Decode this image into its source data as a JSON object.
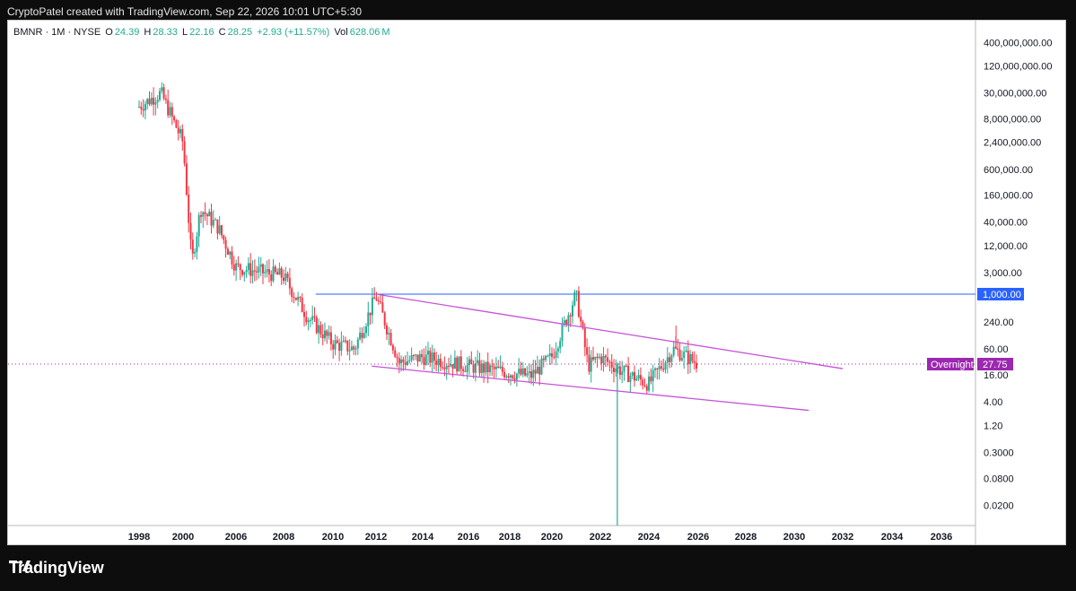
{
  "header": {
    "text": "CryptoPatel created with TradingView.com, Sep 22, 2026 10:01 UTC+5:30"
  },
  "legend": {
    "symbol": "BMNR · 1M · NYSE",
    "o_label": "O",
    "o_value": "24.39",
    "h_label": "H",
    "h_value": "28.33",
    "l_label": "L",
    "l_value": "22.16",
    "c_label": "C",
    "c_value": "28.25",
    "change": "+2.93 (+11.57%)",
    "vol_label": "Vol",
    "vol_value": "628.06",
    "vol_unit": "M"
  },
  "brand": {
    "name": "TradingView"
  },
  "colors": {
    "up": "#22ab94",
    "down": "#f23645",
    "channel": "#c653d8",
    "level": "#2962ff",
    "overnight": "#9c27b0"
  },
  "chart_data": {
    "type": "candlestick",
    "scale": "log",
    "x_ticks": [
      "1998",
      "2000",
      "2006",
      "2008",
      "2010",
      "2012",
      "2014",
      "2016",
      "2018",
      "2020",
      "2022",
      "2024",
      "2026",
      "2028",
      "2030",
      "2032",
      "2034",
      "2036"
    ],
    "y_ticks": [
      "400,000,000.00",
      "120,000,000.00",
      "30,000,000.00",
      "8,000,000.00",
      "2,400,000.00",
      "600,000.00",
      "160,000.00",
      "40,000.00",
      "12,000.00",
      "3,000.00",
      "240.00",
      "60.00",
      "16.00",
      "4.00",
      "1.20",
      "0.3000",
      "0.0800",
      "0.0200"
    ],
    "horizontal_level": {
      "value": 1000,
      "label": "1,000.00"
    },
    "current_price": {
      "label": "Overnight",
      "value": "27.75"
    },
    "series_path": [
      {
        "x": "1998",
        "y": 15000000
      },
      {
        "x": "1999",
        "y": 30000000
      },
      {
        "x": "2000",
        "y": 2400000
      },
      {
        "x": "2001",
        "y": 5000
      },
      {
        "x": "2002",
        "y": 80000
      },
      {
        "x": "2004",
        "y": 30000
      },
      {
        "x": "2006",
        "y": 4000
      },
      {
        "x": "2008",
        "y": 2500
      },
      {
        "x": "2009",
        "y": 300
      },
      {
        "x": "2010",
        "y": 80
      },
      {
        "x": "2011",
        "y": 60
      },
      {
        "x": "2012",
        "y": 900
      },
      {
        "x": "2013",
        "y": 30
      },
      {
        "x": "2014",
        "y": 40
      },
      {
        "x": "2016",
        "y": 25
      },
      {
        "x": "2018",
        "y": 18
      },
      {
        "x": "2019",
        "y": 15
      },
      {
        "x": "2020",
        "y": 40
      },
      {
        "x": "2021",
        "y": 1000
      },
      {
        "x": "2021.5",
        "y": 25
      },
      {
        "x": "2022",
        "y": 40
      },
      {
        "x": "2023",
        "y": 18
      },
      {
        "x": "2024",
        "y": 10
      },
      {
        "x": "2025",
        "y": 60
      },
      {
        "x": "2026",
        "y": 28
      }
    ],
    "channel_upper": {
      "from": {
        "x": "2012",
        "y": 1000
      },
      "to": {
        "x": "2032",
        "y": 22
      }
    },
    "channel_lower": {
      "from": {
        "x": "2011.8",
        "y": 25
      },
      "to": {
        "x": "2030.6",
        "y": 2.6
      }
    }
  }
}
